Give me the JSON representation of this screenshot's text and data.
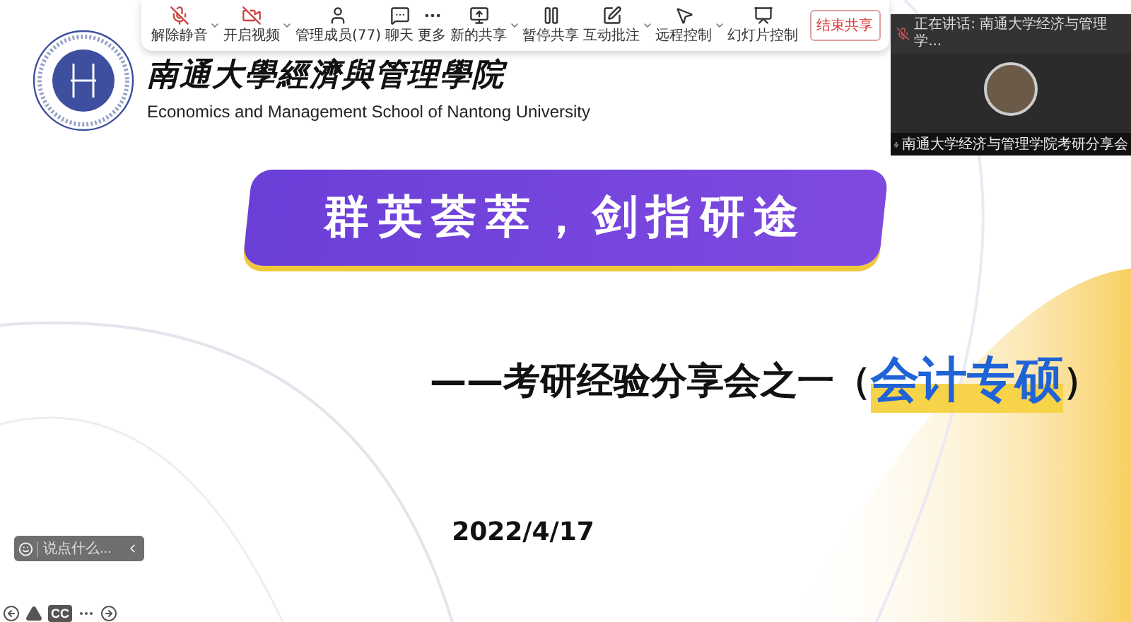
{
  "toolbar": {
    "items": [
      {
        "label": "解除静音",
        "dropdown": true
      },
      {
        "label": "开启视频",
        "dropdown": true
      },
      {
        "label": "管理成员(77)",
        "dropdown": false
      },
      {
        "label": "聊天",
        "dropdown": false
      },
      {
        "label": "更多",
        "dropdown": false
      },
      {
        "label": "新的共享",
        "dropdown": true
      },
      {
        "label": "暂停共享",
        "dropdown": false
      },
      {
        "label": "互动批注",
        "dropdown": true
      },
      {
        "label": "远程控制",
        "dropdown": true
      },
      {
        "label": "幻灯片控制",
        "dropdown": false
      }
    ],
    "end_button": "结束共享"
  },
  "logo": {
    "title_cn": "南通大學經濟與管理學院",
    "title_en": "Economics and Management School of Nantong University"
  },
  "video_panel": {
    "speaker": "正在讲话: 南通大学经济与管理学...",
    "name": "南通大学经济与管理学院考研分享会"
  },
  "slide": {
    "banner": "群英荟萃，剑指研途",
    "subtitle_lead": "——考研经验分享会之一（",
    "subtitle_highlight": "会计专硕",
    "subtitle_tail": "）",
    "date": "2022/4/17"
  },
  "chat": {
    "placeholder": "说点什么..."
  },
  "bottom_bar": {
    "items": [
      {
        "kind": "icon"
      },
      {
        "kind": "icon"
      },
      {
        "kind": "text",
        "label": "CC"
      },
      {
        "kind": "icon"
      },
      {
        "kind": "icon"
      }
    ]
  }
}
